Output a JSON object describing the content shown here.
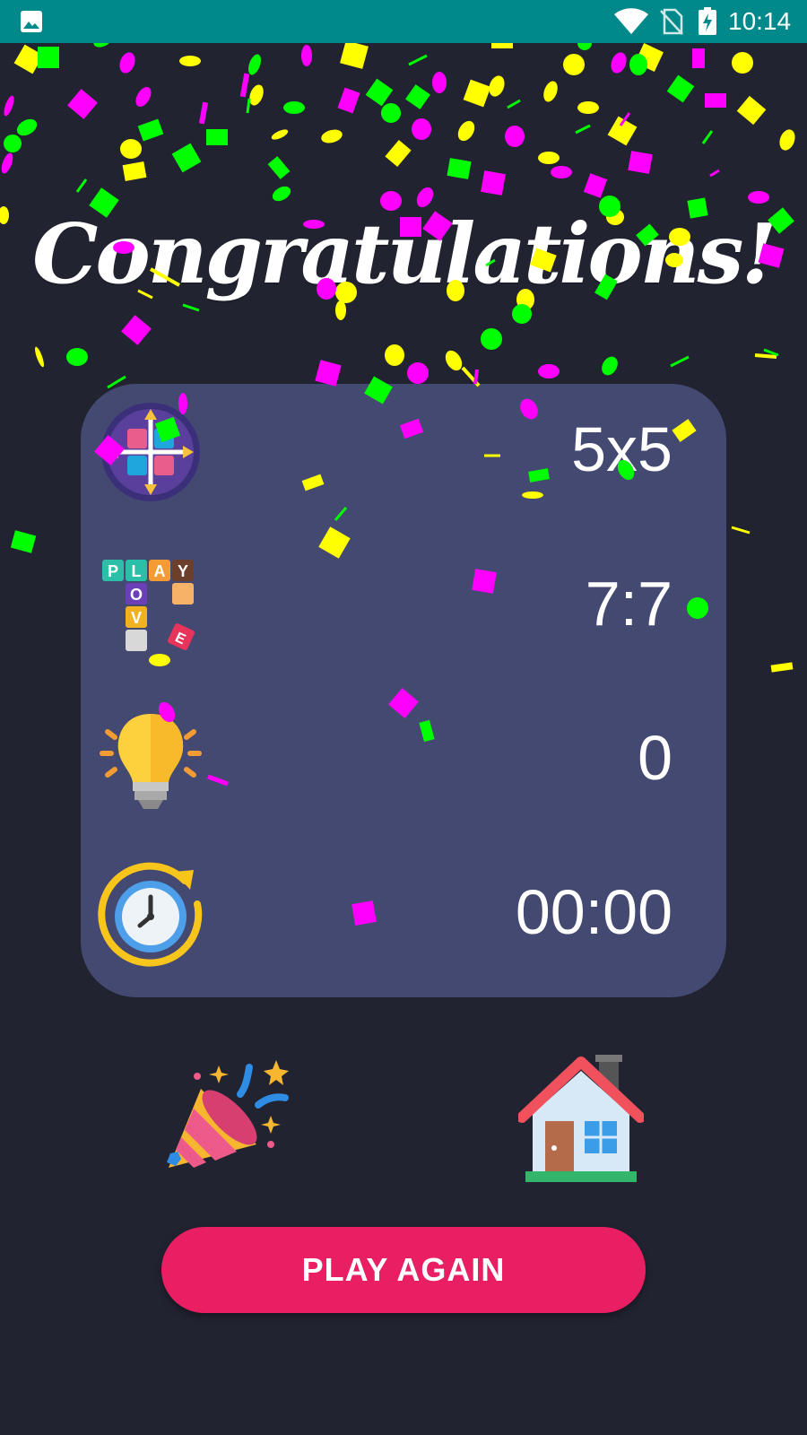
{
  "status_bar": {
    "time": "10:14",
    "icons": [
      "gallery-icon",
      "wifi-icon",
      "no-sim-icon",
      "battery-charging-icon"
    ]
  },
  "title": "Congratulations!",
  "stats": [
    {
      "icon": "grid-size-icon",
      "value": "5x5"
    },
    {
      "icon": "play-tiles-icon",
      "value": "7:7"
    },
    {
      "icon": "lightbulb-icon",
      "value": "0"
    },
    {
      "icon": "timer-icon",
      "value": "00:00"
    }
  ],
  "actions": {
    "party_icon": "party-popper-icon",
    "home_icon": "home-icon",
    "play_again_label": "PLAY AGAIN"
  },
  "colors": {
    "status_bar": "#00898a",
    "background": "#222331",
    "card": "#444972",
    "button": "#e91e63",
    "confetti": [
      "#ffff00",
      "#00ff00",
      "#ff00ff"
    ]
  }
}
